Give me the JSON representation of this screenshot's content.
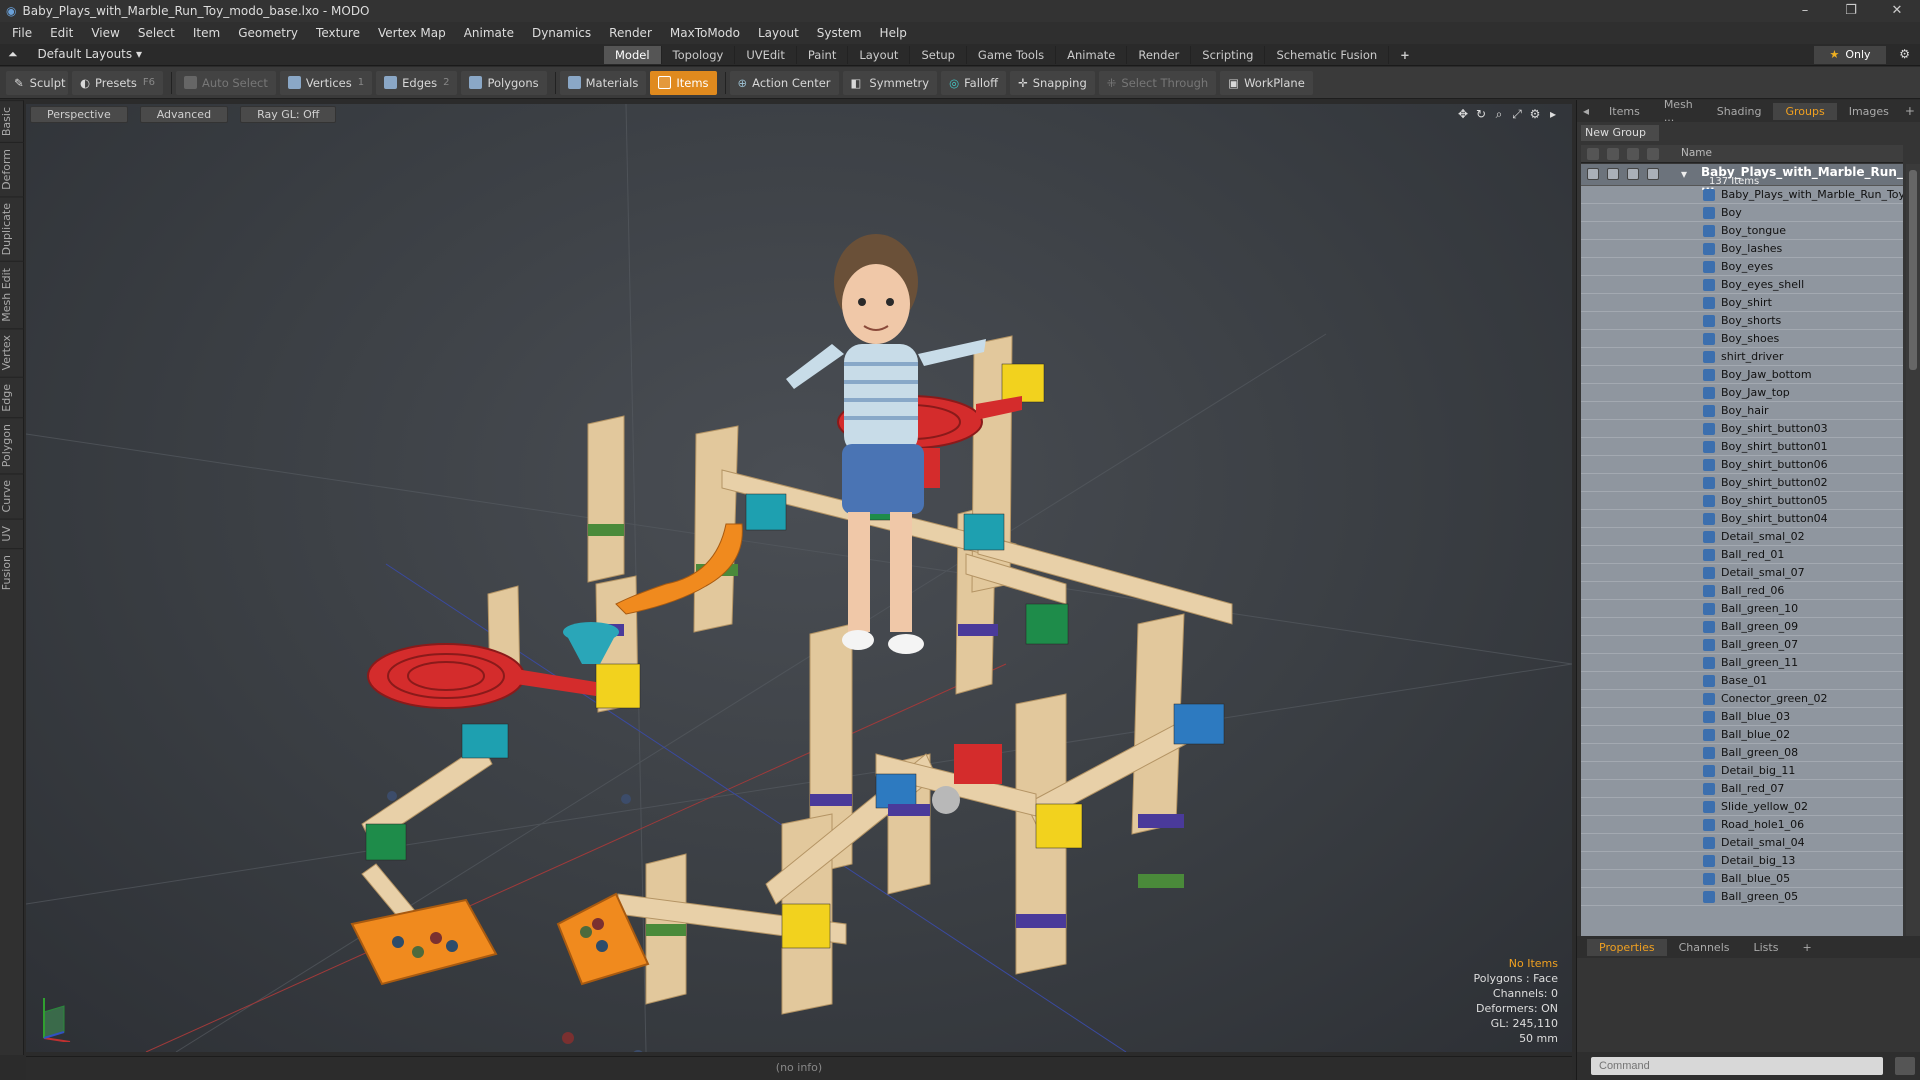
{
  "window": {
    "title": "Baby_Plays_with_Marble_Run_Toy_modo_base.lxo - MODO",
    "controls": [
      "–",
      "❐",
      "✕"
    ]
  },
  "menu": [
    "File",
    "Edit",
    "View",
    "Select",
    "Item",
    "Geometry",
    "Texture",
    "Vertex Map",
    "Animate",
    "Dynamics",
    "Render",
    "MaxToModo",
    "Layout",
    "System",
    "Help"
  ],
  "layout_selector": "Default Layouts ▾",
  "mode_tabs": [
    "Model",
    "Topology",
    "UVEdit",
    "Paint",
    "Layout",
    "Setup",
    "Game Tools",
    "Animate",
    "Render",
    "Scripting",
    "Schematic Fusion",
    "+"
  ],
  "mode_active": "Model",
  "only_button": "Only",
  "toolbar": {
    "sculpt": "Sculpt",
    "presets": "Presets",
    "presets_key": "F6",
    "auto_select": "Auto Select",
    "vertices": "Vertices",
    "vertices_key": "1",
    "edges": "Edges",
    "edges_key": "2",
    "polygons": "Polygons",
    "materials": "Materials",
    "items": "Items",
    "action_center": "Action Center",
    "symmetry": "Symmetry",
    "falloff": "Falloff",
    "snapping": "Snapping",
    "select_through": "Select Through",
    "workplane": "WorkPlane"
  },
  "left_tabs": [
    "Basic",
    "Deform",
    "Duplicate",
    "Mesh Edit",
    "Vertex",
    "Edge",
    "Polygon",
    "Curve",
    "UV",
    "Fusion"
  ],
  "viewport": {
    "view": "Perspective",
    "shading": "Advanced",
    "raygl": "Ray GL: Off",
    "info": {
      "selection": "No Items",
      "polygons": "Polygons : Face",
      "channels": "Channels: 0",
      "deformers": "Deformers: ON",
      "gl": "GL: 245,110",
      "focal": "50 mm"
    }
  },
  "status": "(no info)",
  "right_panel": {
    "tabs": [
      "Items",
      "Mesh ...",
      "Shading",
      "Groups",
      "Images"
    ],
    "active_tab": "Groups",
    "new_group": "New Group",
    "column_name": "Name",
    "scene_name": "Baby_Plays_with_Marble_Run_ ...",
    "scene_count": "137 Items",
    "items": [
      "Baby_Plays_with_Marble_Run_Toy",
      "Boy",
      "Boy_tongue",
      "Boy_lashes",
      "Boy_eyes",
      "Boy_eyes_shell",
      "Boy_shirt",
      "Boy_shorts",
      "Boy_shoes",
      "shirt_driver",
      "Boy_Jaw_bottom",
      "Boy_Jaw_top",
      "Boy_hair",
      "Boy_shirt_button03",
      "Boy_shirt_button01",
      "Boy_shirt_button06",
      "Boy_shirt_button02",
      "Boy_shirt_button05",
      "Boy_shirt_button04",
      "Detail_smal_02",
      "Ball_red_01",
      "Detail_smal_07",
      "Ball_red_06",
      "Ball_green_10",
      "Ball_green_09",
      "Ball_green_07",
      "Ball_green_11",
      "Base_01",
      "Conector_green_02",
      "Ball_blue_03",
      "Ball_blue_02",
      "Ball_green_08",
      "Detail_big_11",
      "Ball_red_07",
      "Slide_yellow_02",
      "Road_hole1_06",
      "Detail_smal_04",
      "Detail_big_13",
      "Ball_blue_05",
      "Ball_green_05"
    ],
    "bottom_tabs": [
      "Properties",
      "Channels",
      "Lists",
      "+"
    ],
    "bottom_active": "Properties",
    "command_placeholder": "Command"
  }
}
